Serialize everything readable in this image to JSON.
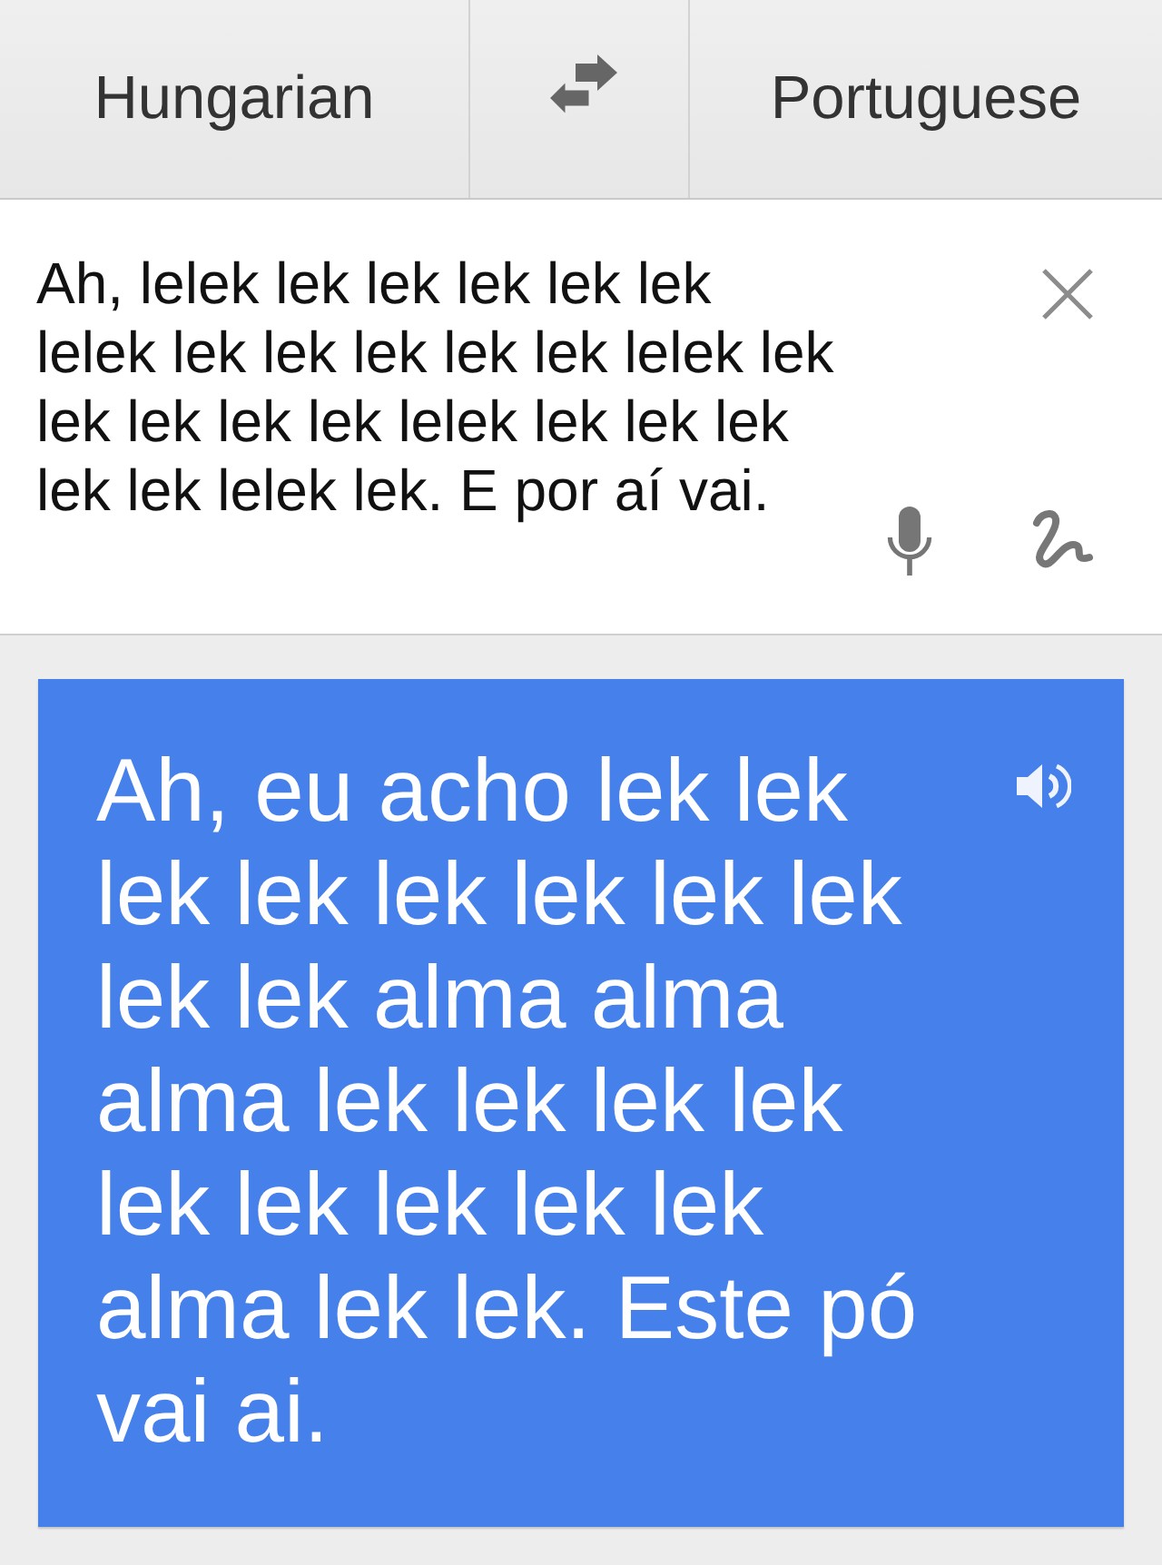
{
  "header": {
    "source_language": "Hungarian",
    "target_language": "Portuguese"
  },
  "input": {
    "value": "Ah, lelek lek lek lek lek lek lelek lek lek lek lek lek lelek lek lek lek lek lek lelek lek lek lek lek lek lelek lek. E por aí vai."
  },
  "translation": {
    "text": "Ah, eu acho lek lek lek lek lek lek lek lek lek lek alma alma alma lek lek lek lek lek lek lek lek lek alma lek lek. Este pó vai ai."
  }
}
